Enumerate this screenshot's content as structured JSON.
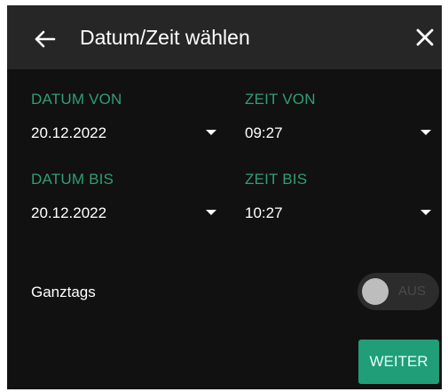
{
  "header": {
    "title": "Datum/Zeit wählen",
    "back_icon": "arrow-left-icon",
    "close_icon": "close-icon"
  },
  "fields": {
    "date_from": {
      "label": "DATUM VON",
      "value": "20.12.2022"
    },
    "time_from": {
      "label": "ZEIT VON",
      "value": "09:27"
    },
    "date_to": {
      "label": "DATUM BIS",
      "value": "20.12.2022"
    },
    "time_to": {
      "label": "ZEIT BIS",
      "value": "10:27"
    }
  },
  "all_day": {
    "label": "Ganztags",
    "toggle_text": "AUS",
    "enabled": false
  },
  "actions": {
    "next_label": "WEITER"
  },
  "colors": {
    "accent": "#2e9f74",
    "button": "#1f9e78",
    "header_bg": "#262626",
    "dialog_bg": "#111111"
  }
}
